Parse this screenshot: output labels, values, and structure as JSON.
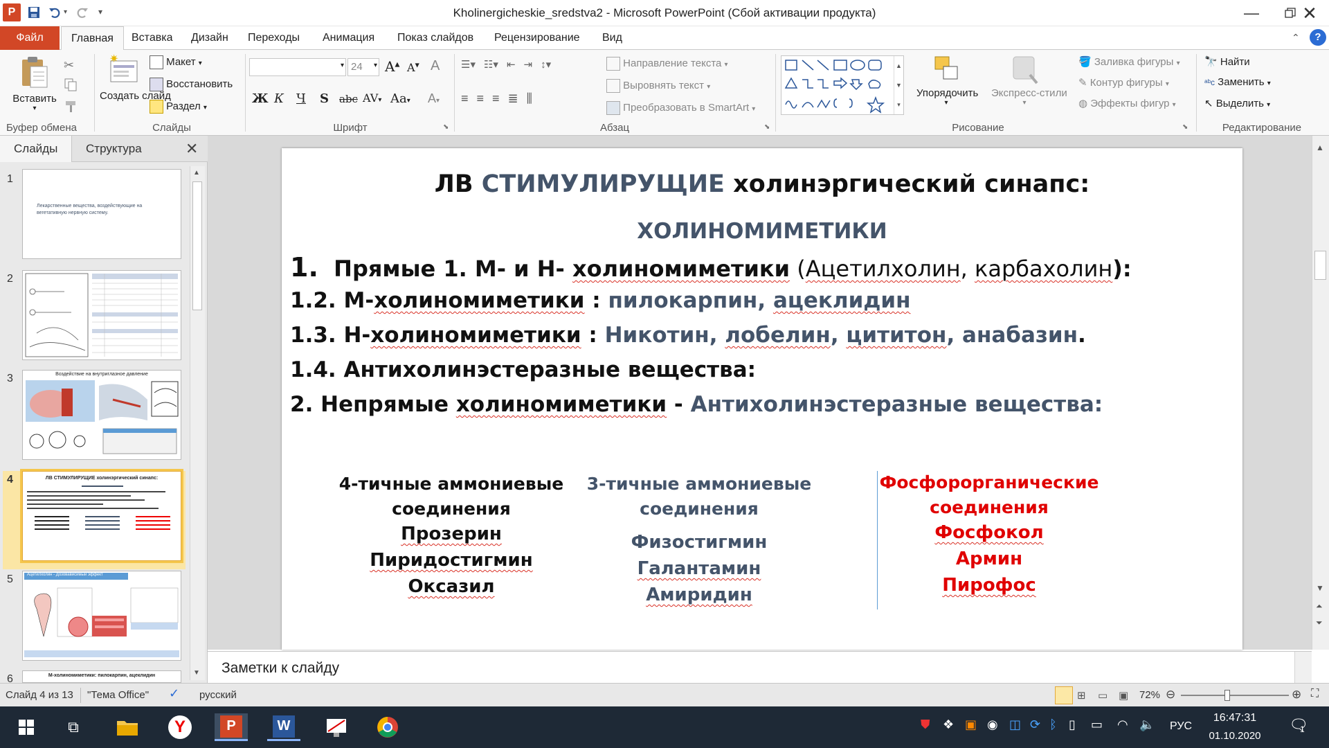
{
  "window": {
    "title": "Kholinergicheskie_sredstva2 - Microsoft PowerPoint (Сбой активации продукта)",
    "app_icon": "powerpoint-icon",
    "quick_access": [
      "save-icon",
      "undo-icon",
      "redo-icon",
      "customize-icon"
    ]
  },
  "tabs": [
    {
      "label": "Файл"
    },
    {
      "label": "Главная"
    },
    {
      "label": "Вставка"
    },
    {
      "label": "Дизайн"
    },
    {
      "label": "Переходы"
    },
    {
      "label": "Анимация"
    },
    {
      "label": "Показ слайдов"
    },
    {
      "label": "Рецензирование"
    },
    {
      "label": "Вид"
    }
  ],
  "ribbon": {
    "clipboard": {
      "label": "Буфер обмена",
      "paste": "Вставить"
    },
    "slides": {
      "label": "Слайды",
      "new_slide": "Создать слайд",
      "layout": "Макет",
      "reset": "Восстановить",
      "section": "Раздел"
    },
    "font": {
      "label": "Шрифт",
      "font_size": "24",
      "bold": "Ж",
      "italic": "К",
      "underline": "Ч",
      "strike": "S",
      "abc": "abc",
      "spacing": "AV",
      "case": "Aa",
      "size_up": "A",
      "size_down": "A",
      "clear": "A"
    },
    "paragraph": {
      "label": "Абзац",
      "text_direction": "Направление текста",
      "align_text": "Выровнять текст",
      "smartart": "Преобразовать в SmartArt"
    },
    "drawing": {
      "label": "Рисование",
      "arrange": "Упорядочить",
      "quick_styles": "Экспресс-стили",
      "fill": "Заливка фигуры",
      "outline": "Контур фигуры",
      "effects": "Эффекты фигур"
    },
    "editing": {
      "label": "Редактирование",
      "find": "Найти",
      "replace": "Заменить",
      "select": "Выделить"
    }
  },
  "left_pane": {
    "tabs": [
      "Слайды",
      "Структура"
    ],
    "slides": [
      {
        "num": "1",
        "caption": "Лекарственные вещества, воздействующие на вегетативную нервную систему."
      },
      {
        "num": "2"
      },
      {
        "num": "3",
        "caption": "Воздействие на внутриглазное давление"
      },
      {
        "num": "4",
        "caption": "ЛВ СТИМУЛИРУЩИЕ холинэргический синапс:"
      },
      {
        "num": "5",
        "caption": "Ацетилхолин - Дозовависимый эффект"
      },
      {
        "num": "6",
        "caption": "М-холиномиметики: пилокарпин, ацеклидин"
      }
    ],
    "selected": "4"
  },
  "slide": {
    "title_part1": "ЛВ ",
    "title_part2": "СТИМУЛИРУЩИЕ",
    "title_part3": " холинэргический синапс:",
    "subtitle": "ХОЛИНОМИМЕТИКИ",
    "l1_num": "1.",
    "l1_a": "Прямые 1. М- и Н- ",
    "l1_b": "холиномиметики",
    "l1_c": "  (",
    "l1_d": "Ацетилхолин",
    "l1_e": ", ",
    "l1_f": "карбахолин",
    "l1_g": "):",
    "l2_a": "1.2. М-",
    "l2_b": "холиномиметики",
    "l2_c": " : ",
    "l2_d": "пилокарпин",
    "l2_e": ", ",
    "l2_f": "ацеклидин",
    "l3_a": "1.3. Н-",
    "l3_b": "холиномиметики",
    "l3_c": " : ",
    "l3_d": "Никотин",
    "l3_e": ", ",
    "l3_f": "лобелин",
    "l3_g": ", ",
    "l3_h": "цититон",
    "l3_i": ", анабазин",
    "l3_j": ".",
    "l4": "1.4. Антихолинэстеразные  вещества:",
    "l5_a": "2.   Непрямые ",
    "l5_b": "холиномиметики",
    "l5_c": " - ",
    "l5_d": "Антихолинэстеразные  вещества:",
    "col1": {
      "h1": "4-тичные аммониевые",
      "h2": "соединения",
      "items": [
        "Прозерин",
        "Пиридостигмин",
        "Оксазил"
      ]
    },
    "col2": {
      "h1": "3-тичные аммониевые",
      "h2": "соединения",
      "items": [
        "Физостигмин",
        "Галантамин",
        "Амиридин"
      ]
    },
    "col3": {
      "h1": "Фосфорорганические",
      "h2": "соединения",
      "items": [
        "Фосфокол",
        "Армин",
        "Пирофос"
      ]
    }
  },
  "notes_placeholder": "Заметки к слайду",
  "status": {
    "slide_info": "Слайд 4 из 13",
    "theme": "\"Тема Office\"",
    "language": "русский",
    "zoom": "72%",
    "zoom_level": 0.43
  },
  "taskbar": {
    "lang": "РУС",
    "time": "16:47:31",
    "date": "01.10.2020",
    "notifications": "1"
  },
  "colors": {
    "accent_red": "#d24726",
    "slide_blue": "#44546a",
    "red_text": "#e00000",
    "selection": "#f5c64c"
  }
}
